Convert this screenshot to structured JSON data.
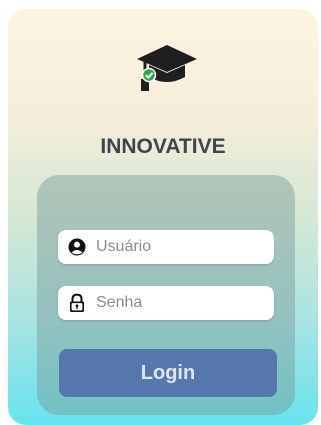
{
  "brand": {
    "name": "INNOVATIVE",
    "logo_icon": "graduation-cap-icon"
  },
  "form": {
    "username": {
      "placeholder": "Usuário",
      "icon": "user-circle-icon"
    },
    "password": {
      "placeholder": "Senha",
      "icon": "lock-icon"
    },
    "submit_label": "Login"
  },
  "colors": {
    "button_bg": "#5677ab",
    "brand_text": "#3f4550",
    "check_badge": "#2ea84f"
  }
}
